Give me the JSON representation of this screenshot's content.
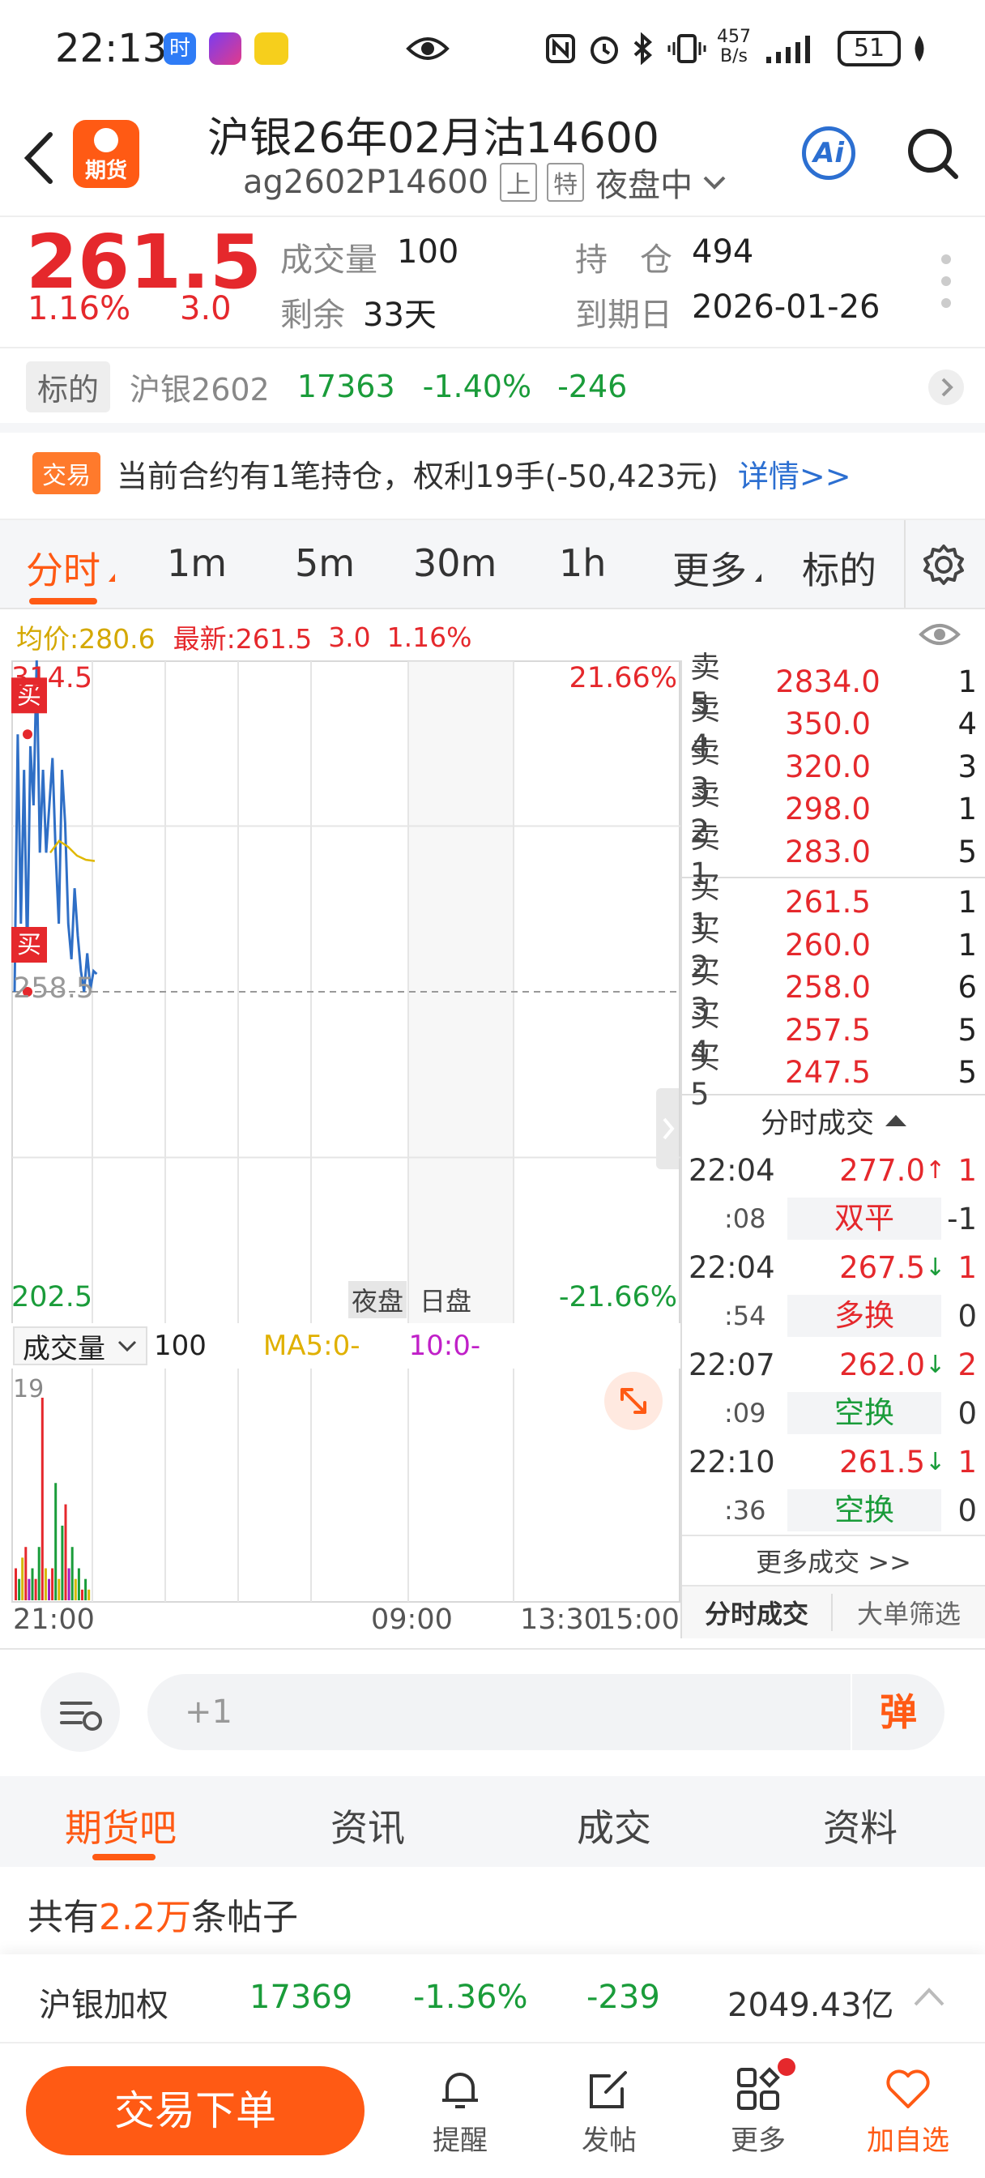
{
  "status_bar": {
    "time": "22:13",
    "net_speed_top": "457",
    "net_speed_bottom": "B/s",
    "battery": "51"
  },
  "header": {
    "badge": "期货",
    "title": "沪银26年02月沽14600",
    "code": "ag2602P14600",
    "tag_exchange": "上",
    "tag_special": "特",
    "session": "夜盘中",
    "ai_label": "Ai"
  },
  "quote": {
    "last_price": "261.5",
    "change_pct": "1.16%",
    "change": "3.0",
    "volume_label": "成交量",
    "volume": "100",
    "oi_label": "持　仓",
    "oi": "494",
    "remain_label": "剩余",
    "remain": "33天",
    "expiry_label": "到期日",
    "expiry": "2026-01-26"
  },
  "underlying": {
    "tag": "标的",
    "name": "沪银2602",
    "price": "17363",
    "pct": "-1.40%",
    "chg": "-246"
  },
  "position_notice": {
    "tag": "交易",
    "text": "当前合约有1笔持仓，权利19手(-50,423元)",
    "link": "详情>>"
  },
  "tabs": [
    {
      "label": "分时",
      "active": true
    },
    {
      "label": "1m"
    },
    {
      "label": "5m"
    },
    {
      "label": "30m"
    },
    {
      "label": "1h"
    },
    {
      "label": "更多"
    },
    {
      "label": "标的"
    }
  ],
  "info_line": {
    "avg": "均价:280.6",
    "latest": "最新:261.5",
    "chg": "3.0",
    "pct": "1.16%"
  },
  "chart": {
    "y_top": "314.5",
    "y_top_pct": "21.66%",
    "y_mid": "258.5",
    "y_bottom": "202.5",
    "y_bottom_pct": "-21.66%",
    "session_night": "夜盘",
    "session_day": "日盘",
    "buy_marker": "买",
    "vol_selector": "成交量",
    "vol_value": "100",
    "ma5": "MA5:0-",
    "ma10": "10:0-",
    "vol_max": "19",
    "x_labels": [
      "21:00",
      "09:00",
      "13:30",
      "15:00"
    ],
    "price_line": [
      258.5,
      302,
      270,
      296,
      264,
      300,
      290,
      314.5,
      282,
      296,
      282,
      290,
      298,
      282,
      270,
      296,
      287,
      270,
      264,
      276,
      268,
      262,
      258.5,
      265,
      259,
      262,
      261.5
    ],
    "avg_line": [
      282,
      284,
      283,
      281.5,
      280.8,
      280.6
    ],
    "volume_bars": [
      {
        "v": 3,
        "c": "#e5282c"
      },
      {
        "v": 2,
        "c": "#1a9c3a"
      },
      {
        "v": 4,
        "c": "#d4b800"
      },
      {
        "v": 5,
        "c": "#e5282c"
      },
      {
        "v": 2,
        "c": "#a020c0"
      },
      {
        "v": 3,
        "c": "#1a9c3a"
      },
      {
        "v": 2,
        "c": "#e5282c"
      },
      {
        "v": 5,
        "c": "#1a9c3a"
      },
      {
        "v": 19,
        "c": "#e5282c"
      },
      {
        "v": 3,
        "c": "#d4b800"
      },
      {
        "v": 2,
        "c": "#a020c0"
      },
      {
        "v": 3,
        "c": "#e5282c"
      },
      {
        "v": 11,
        "c": "#1a9c3a"
      },
      {
        "v": 2,
        "c": "#d4b800"
      },
      {
        "v": 7,
        "c": "#1a9c3a"
      },
      {
        "v": 9,
        "c": "#e5282c"
      },
      {
        "v": 3,
        "c": "#a020c0"
      },
      {
        "v": 5,
        "c": "#1a9c3a"
      },
      {
        "v": 2,
        "c": "#d4b800"
      },
      {
        "v": 3,
        "c": "#1a9c3a"
      },
      {
        "v": 1,
        "c": "#e5282c"
      },
      {
        "v": 2,
        "c": "#1a9c3a"
      },
      {
        "v": 1,
        "c": "#d4b800"
      }
    ]
  },
  "order_book": {
    "asks": [
      {
        "label": "卖5",
        "price": "2834.0",
        "vol": "1"
      },
      {
        "label": "卖4",
        "price": "350.0",
        "vol": "4"
      },
      {
        "label": "卖3",
        "price": "320.0",
        "vol": "3"
      },
      {
        "label": "卖2",
        "price": "298.0",
        "vol": "1"
      },
      {
        "label": "卖1",
        "price": "283.0",
        "vol": "5"
      }
    ],
    "bids": [
      {
        "label": "买1",
        "price": "261.5",
        "vol": "1"
      },
      {
        "label": "买2",
        "price": "260.0",
        "vol": "1"
      },
      {
        "label": "买3",
        "price": "258.0",
        "vol": "6"
      },
      {
        "label": "买4",
        "price": "257.5",
        "vol": "5"
      },
      {
        "label": "买5",
        "price": "247.5",
        "vol": "5"
      }
    ]
  },
  "ticks": {
    "title": "分时成交",
    "rows": [
      {
        "time": "22:04",
        "sec": ":08",
        "price": "277.0",
        "dir": "↑",
        "vol": "1",
        "type": "双平",
        "oi": "-1",
        "type_color": "red"
      },
      {
        "time": "22:04",
        "sec": ":54",
        "price": "267.5",
        "dir": "↓",
        "vol": "1",
        "type": "多换",
        "oi": "0",
        "type_color": "red"
      },
      {
        "time": "22:07",
        "sec": ":09",
        "price": "262.0",
        "dir": "↓",
        "vol": "2",
        "type": "空换",
        "oi": "0",
        "type_color": "green"
      },
      {
        "time": "22:10",
        "sec": ":36",
        "price": "261.5",
        "dir": "↓",
        "vol": "1",
        "type": "空换",
        "oi": "0",
        "type_color": "green"
      }
    ],
    "more": "更多成交 >>",
    "bottom_tab_active": "分时成交",
    "bottom_tab_other": "大单筛选"
  },
  "comment_bar": {
    "placeholder": "+1",
    "danmu": "弹"
  },
  "section_tabs": [
    {
      "label": "期货吧",
      "active": true
    },
    {
      "label": "资讯"
    },
    {
      "label": "成交"
    },
    {
      "label": "资料"
    }
  ],
  "posts": {
    "prefix": "共有",
    "count": "2.2万",
    "suffix": "条帖子"
  },
  "index_bar": {
    "name": "沪银加权",
    "price": "17369",
    "pct": "-1.36%",
    "chg": "-239",
    "amount": "2049.43亿"
  },
  "bottom_nav": {
    "trade_button": "交易下单",
    "items": [
      "提醒",
      "发帖",
      "更多",
      "加自选"
    ]
  },
  "colors": {
    "accent": "#ff5a14",
    "up": "#e5282c",
    "down": "#1a9c3a",
    "link": "#2c6fd1"
  }
}
